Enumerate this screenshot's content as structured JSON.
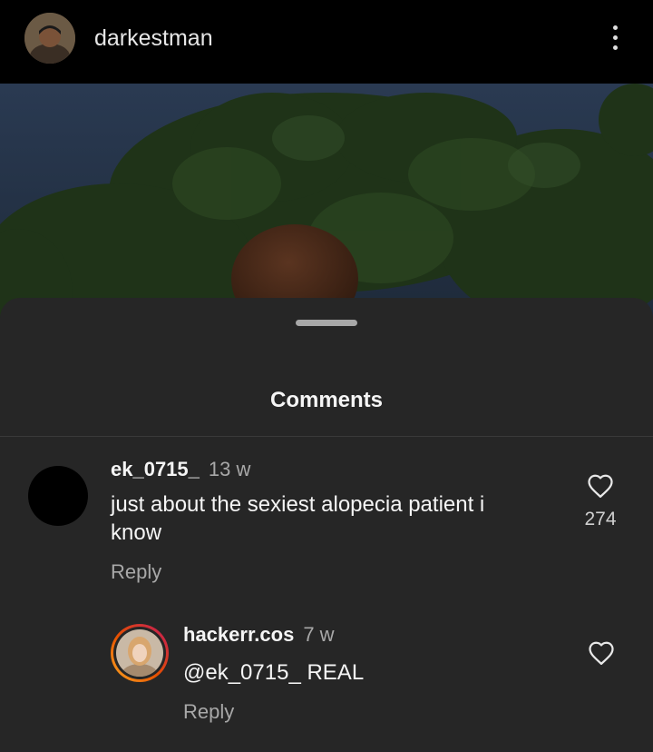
{
  "header": {
    "username": "darkestman",
    "avatar_icon": "profile-avatar",
    "more_icon": "more-vertical-icon"
  },
  "sheet": {
    "title": "Comments"
  },
  "comments": [
    {
      "user": "ek_0715_",
      "time": "13 w",
      "text": "just about the sexiest alopecia patient i know",
      "reply_label": "Reply",
      "likes": "274"
    }
  ],
  "replies": [
    {
      "user": "hackerr.cos",
      "time": "7 w",
      "text": "@ek_0715_ REAL",
      "reply_label": "Reply"
    }
  ],
  "colors": {
    "sheet_bg": "#262626",
    "text_primary": "#f5f5f5",
    "text_secondary": "#a8a8a8",
    "story_ring_start": "#f9a825",
    "story_ring_end": "#c2185b"
  }
}
